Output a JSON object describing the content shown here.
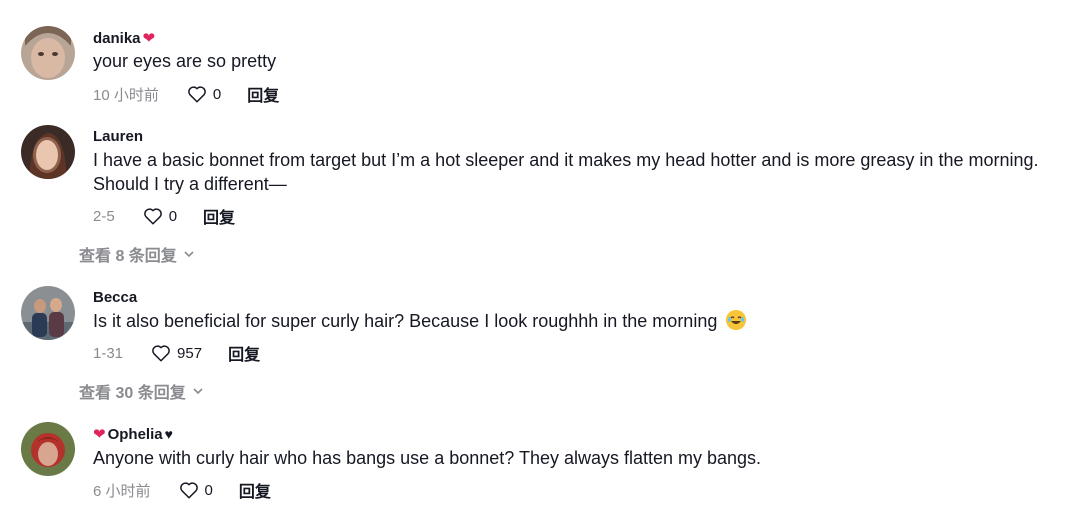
{
  "comments": [
    {
      "author": "danika",
      "author_suffix": "❤",
      "text": "your eyes are so pretty",
      "time": "10 小时前",
      "likes": "0",
      "reply": "回复"
    },
    {
      "author": "Lauren",
      "text": "I have a basic bonnet from target but I’m a hot sleeper and it makes my head hotter and is more greasy in the morning. Should I try a different—",
      "time": "2-5",
      "likes": "0",
      "reply": "回复",
      "view_replies": "查看 8 条回复"
    },
    {
      "author": "Becca",
      "text": "Is it also beneficial for super curly hair? Because I look roughhh in the morning",
      "time": "1-31",
      "likes": "957",
      "reply": "回复",
      "view_replies": "查看 30 条回复"
    },
    {
      "author_prefix": "❤",
      "author": "Ophelia",
      "author_suffix": "♥",
      "text": "Anyone with curly hair who has bangs use a bonnet? They always flatten my bangs.",
      "time": "6 小时前",
      "likes": "0",
      "reply": "回复"
    }
  ],
  "icons": {
    "like": "heart-outline-icon",
    "expand": "chevron-down-icon",
    "emoji": "laughing-emoji-icon"
  }
}
